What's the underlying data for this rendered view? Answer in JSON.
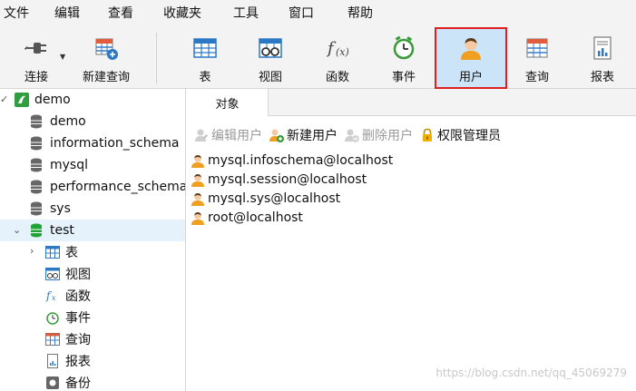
{
  "menu": [
    "文件",
    "编辑",
    "查看",
    "收藏夹",
    "工具",
    "窗口",
    "帮助"
  ],
  "toolbar": {
    "connect": "连接",
    "new_query": "新建查询",
    "table": "表",
    "view": "视图",
    "function": "函数",
    "event": "事件",
    "user": "用户",
    "query": "查询",
    "report": "报表"
  },
  "tree": {
    "connection": "demo",
    "databases": [
      "demo",
      "information_schema",
      "mysql",
      "performance_schema",
      "sys",
      "test"
    ],
    "test_children": [
      "表",
      "视图",
      "函数",
      "事件",
      "查询",
      "报表",
      "备份"
    ]
  },
  "tab": "对象",
  "actions": {
    "edit_user": "编辑用户",
    "new_user": "新建用户",
    "delete_user": "删除用户",
    "privilege_manager": "权限管理员"
  },
  "users": [
    "mysql.infoschema@localhost",
    "mysql.session@localhost",
    "mysql.sys@localhost",
    "root@localhost"
  ],
  "watermark": "https://blog.csdn.net/qq_45069279",
  "colors": {
    "accent": "#cce4f7",
    "highlight_border": "#e02020",
    "db_green": "#22a33a",
    "selected_row": "#e5f1fb"
  }
}
